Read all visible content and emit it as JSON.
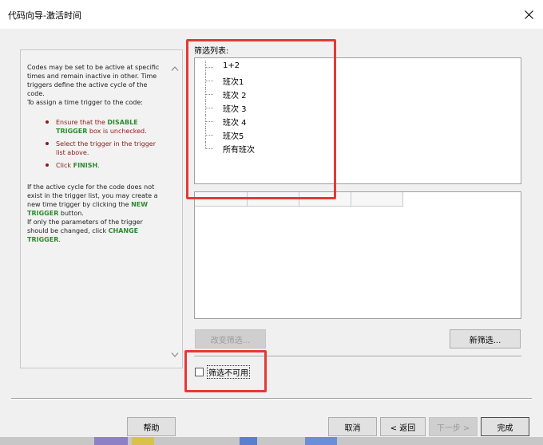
{
  "window": {
    "title": "代码向导-激活时间"
  },
  "help": {
    "intro": "Codes may be set to be active at specific times and remain inactive in other. Time triggers define the active cycle of the code.",
    "assign": "To assign a time trigger to the code:",
    "step1_pre": "Ensure that the ",
    "step1_kw": "DISABLE TRIGGER",
    "step1_post": " box is unchecked.",
    "step2": "Select the trigger in the trigger list above.",
    "step3_pre": "Click ",
    "step3_kw": "FINISH",
    "step3_post": ".",
    "new_pre": "If the active cycle for the code does not exist in the trigger list, you may create a new time trigger by clicking the ",
    "new_kw": "NEW TRIGGER",
    "new_post": " button.",
    "change_pre": "If only the parameters of the trigger should be changed, click ",
    "change_kw": "CHANGE TRIGGER",
    "change_post": "."
  },
  "filter": {
    "label": "筛选列表:",
    "items": [
      "1+2",
      "班次1",
      "班次 2",
      "班次 3",
      "班次 4",
      "班次5",
      "所有班次"
    ]
  },
  "buttons": {
    "change_filter": "改变筛选...",
    "new_filter": "新筛选...",
    "help": "帮助",
    "cancel": "取消",
    "back": "< 返回",
    "next": "下一步 >",
    "finish": "完成"
  },
  "checkbox": {
    "label": "筛选不可用",
    "checked": false
  },
  "colors": {
    "highlight_box": "#e53935",
    "keyword_green": "#2e8b2e",
    "bullet_red": "#8b1a1a"
  }
}
